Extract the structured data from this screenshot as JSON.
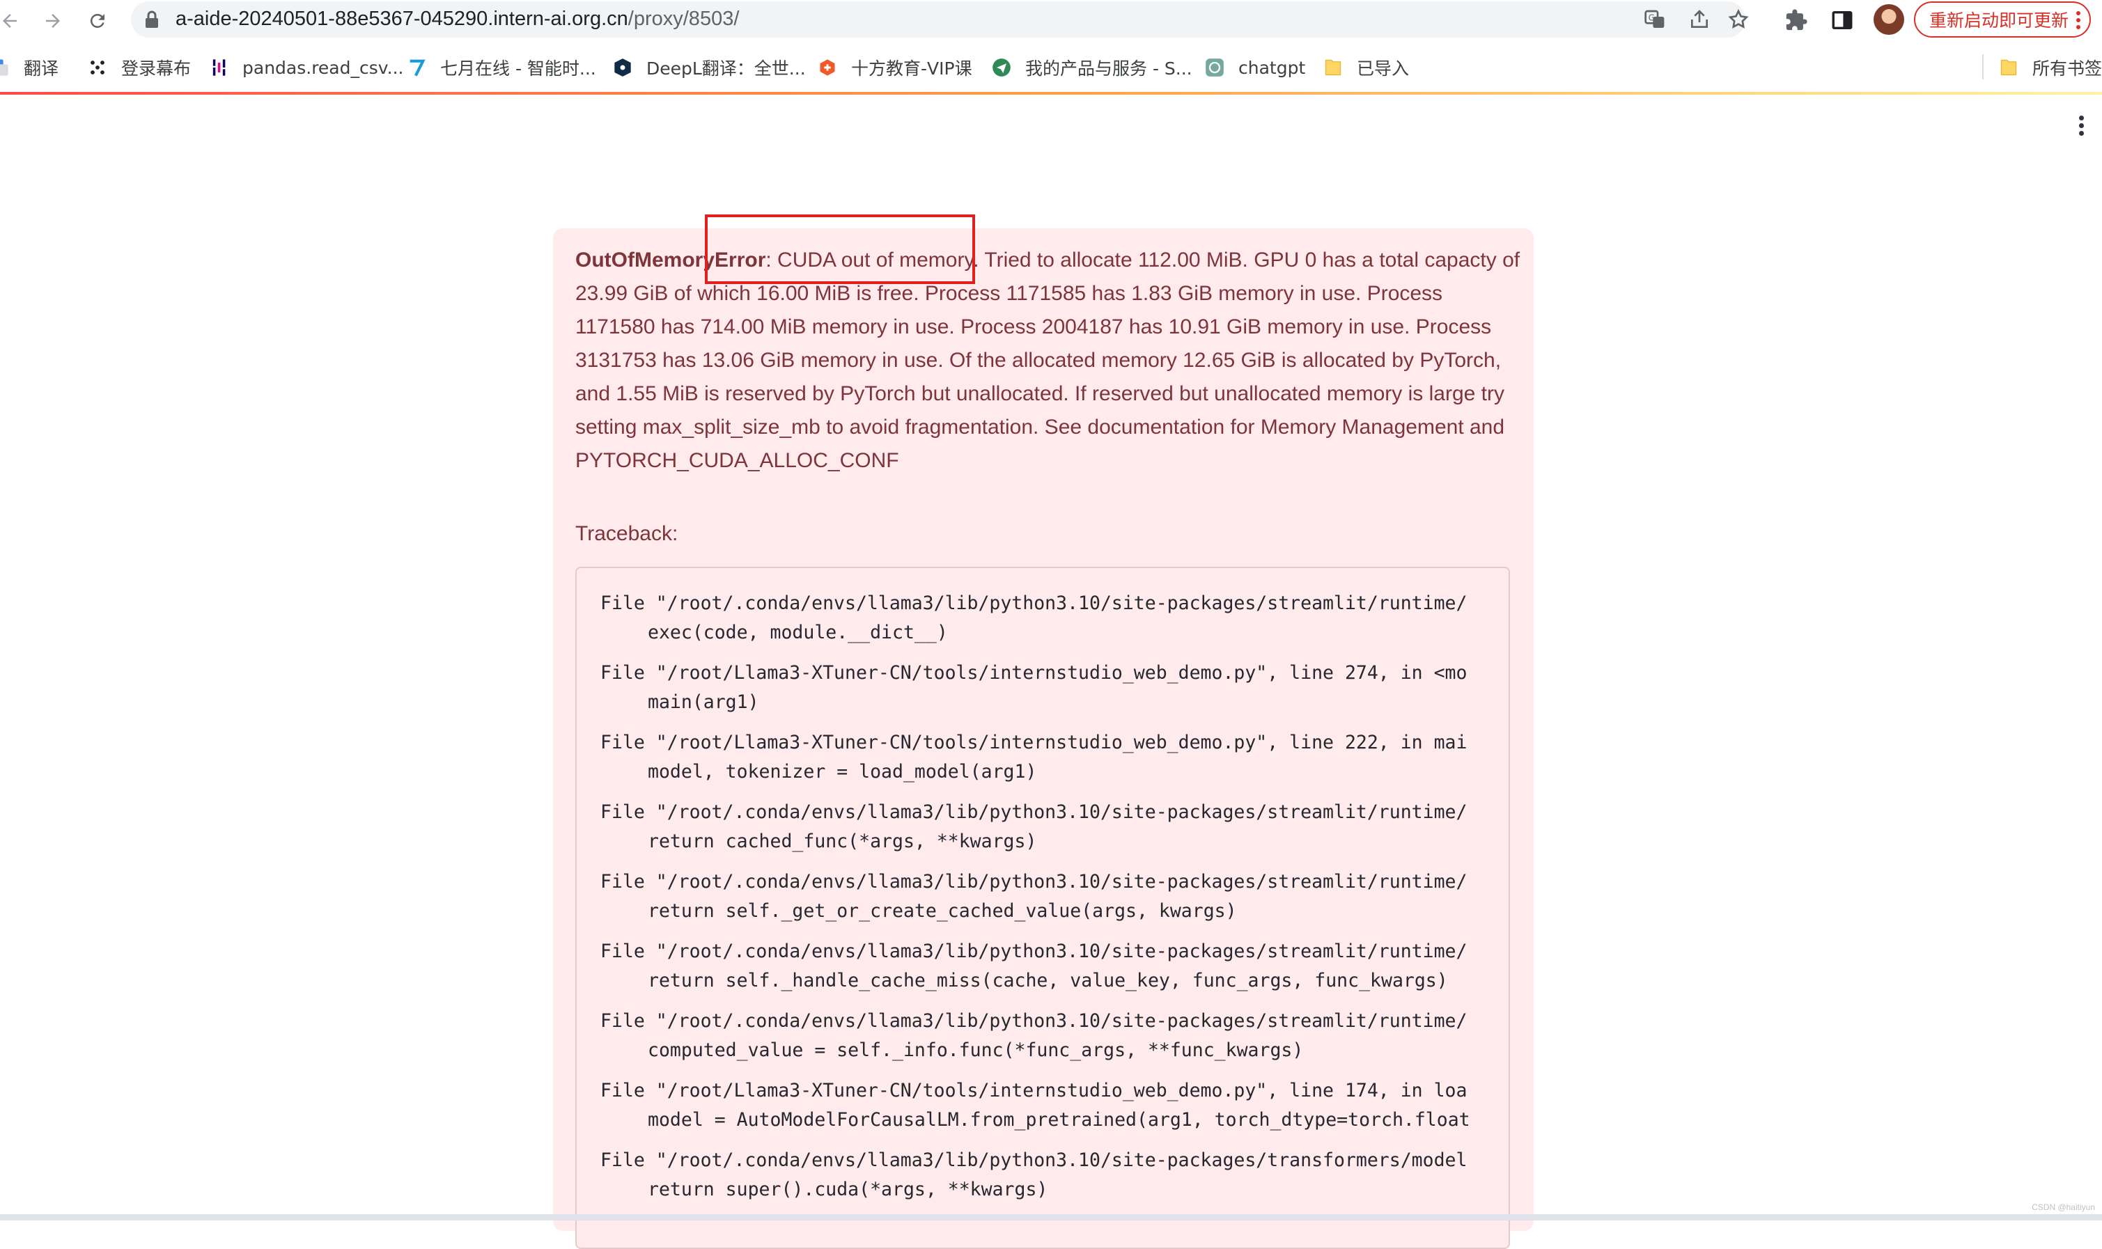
{
  "browser": {
    "url_host": "a-aide-20240501-88e5367-045290.intern-ai.org.cn",
    "url_path": "/proxy/8503/",
    "update_button_label": "重新启动即可更新",
    "bookmarks": [
      {
        "label": "翻译",
        "icon": "google-translate-icon"
      },
      {
        "label": "登录幕布",
        "icon": "mubu-icon"
      },
      {
        "label": "pandas.read_csv...",
        "icon": "pandas-icon"
      },
      {
        "label": "七月在线 - 智能时...",
        "icon": "julyedu-icon"
      },
      {
        "label": "DeepL翻译：全世...",
        "icon": "deepl-icon"
      },
      {
        "label": "十方教育-VIP课",
        "icon": "shifang-icon"
      },
      {
        "label": "我的产品与服务 - S...",
        "icon": "paper-plane-icon"
      },
      {
        "label": "chatgpt",
        "icon": "openai-icon"
      },
      {
        "label": "已导入",
        "icon": "folder-icon"
      }
    ],
    "all_bookmarks_label": "所有书签"
  },
  "error": {
    "type": "OutOfMemoryError",
    "message": ": CUDA out of memory. Tried to allocate 112.00 MiB. GPU 0 has a total capacty of 23.99 GiB of which 16.00 MiB is free. Process 1171585 has 1.83 GiB memory in use. Process 1171580 has 714.00 MiB memory in use. Process 2004187 has 10.91 GiB memory in use. Process 3131753 has 13.06 GiB memory in use. Of the allocated memory 12.65 GiB is allocated by PyTorch, and 1.55 MiB is reserved by PyTorch but unallocated. If reserved but unallocated memory is large try setting max_split_size_mb to avoid fragmentation. See documentation for Memory Management and PYTORCH_CUDA_ALLOC_CONF",
    "traceback_label": "Traceback:",
    "traceback": [
      {
        "file": "File \"/root/.conda/envs/llama3/lib/python3.10/site-packages/streamlit/runtime/",
        "code": "exec(code, module.__dict__)"
      },
      {
        "file": "File \"/root/Llama3-XTuner-CN/tools/internstudio_web_demo.py\", line 274, in <mo",
        "code": "main(arg1)"
      },
      {
        "file": "File \"/root/Llama3-XTuner-CN/tools/internstudio_web_demo.py\", line 222, in mai",
        "code": "model, tokenizer = load_model(arg1)"
      },
      {
        "file": "File \"/root/.conda/envs/llama3/lib/python3.10/site-packages/streamlit/runtime/",
        "code": "return cached_func(*args, **kwargs)"
      },
      {
        "file": "File \"/root/.conda/envs/llama3/lib/python3.10/site-packages/streamlit/runtime/",
        "code": "return self._get_or_create_cached_value(args, kwargs)"
      },
      {
        "file": "File \"/root/.conda/envs/llama3/lib/python3.10/site-packages/streamlit/runtime/",
        "code": "return self._handle_cache_miss(cache, value_key, func_args, func_kwargs)"
      },
      {
        "file": "File \"/root/.conda/envs/llama3/lib/python3.10/site-packages/streamlit/runtime/",
        "code": "computed_value = self._info.func(*func_args, **func_kwargs)"
      },
      {
        "file": "File \"/root/Llama3-XTuner-CN/tools/internstudio_web_demo.py\", line 174, in loa",
        "code": "model = AutoModelForCausalLM.from_pretrained(arg1, torch_dtype=torch.float"
      },
      {
        "file": "File \"/root/.conda/envs/llama3/lib/python3.10/site-packages/transformers/model",
        "code": "return super().cuda(*args, **kwargs)"
      }
    ]
  },
  "watermark": "CSDN @haitiyun",
  "colors": {
    "error_bg": "#ffebeb",
    "error_text": "#7d353b",
    "annotation": "#e02020"
  }
}
